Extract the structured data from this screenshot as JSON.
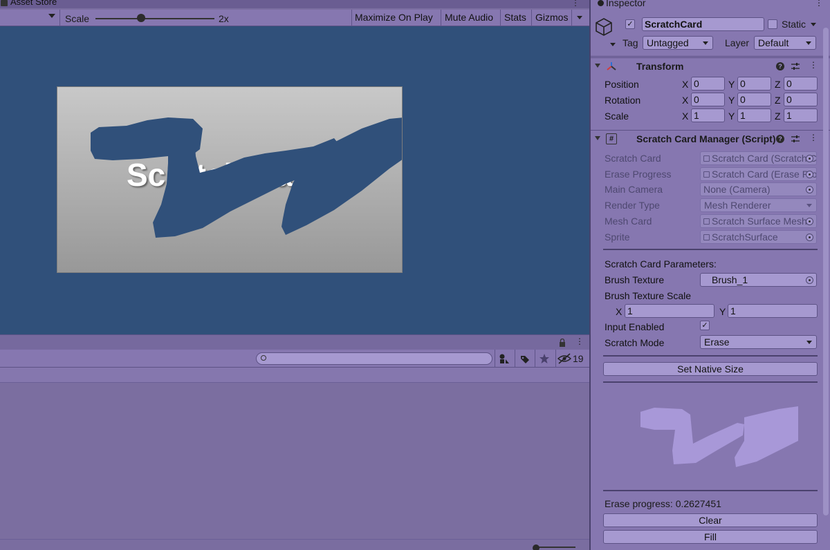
{
  "game_tab": {
    "title": "Asset Store"
  },
  "game_toolbar": {
    "scale_label": "Scale",
    "scale_value": "2x",
    "scale_slider_position": 0.37,
    "buttons": [
      "Maximize On Play",
      "Mute Audio",
      "Stats",
      "Gizmos"
    ]
  },
  "game_view": {
    "background_color": "#30507a",
    "card_text": "Scratch Card"
  },
  "project_panel": {
    "search": {
      "value": "",
      "placeholder": ""
    },
    "hidden_count": "19"
  },
  "inspector": {
    "tab_title": "Inspector",
    "object": {
      "active": true,
      "name": "ScratchCard",
      "static_label": "Static",
      "tag_label": "Tag",
      "tag_value": "Untagged",
      "layer_label": "Layer",
      "layer_value": "Default"
    },
    "transform": {
      "title": "Transform",
      "rows": [
        {
          "label": "Position",
          "x": "0",
          "y": "0",
          "z": "0"
        },
        {
          "label": "Rotation",
          "x": "0",
          "y": "0",
          "z": "0"
        },
        {
          "label": "Scale",
          "x": "1",
          "y": "1",
          "z": "1"
        }
      ],
      "axes": [
        "X",
        "Y",
        "Z"
      ]
    },
    "manager": {
      "title": "Scratch Card Manager (Script)",
      "fields": [
        {
          "label": "Scratch Card",
          "value": "Scratch Card (Scratch Card)"
        },
        {
          "label": "Erase Progress",
          "value": "Scratch Card (Erase Progress)"
        },
        {
          "label": "Main Camera",
          "value": "None (Camera)"
        },
        {
          "label": "Render Type",
          "value": "Mesh Renderer"
        },
        {
          "label": "Mesh Card",
          "value": "Scratch Surface Mesh"
        },
        {
          "label": "Sprite",
          "value": "ScratchSurface"
        }
      ],
      "params_heading": "Scratch Card Parameters:",
      "brush_texture_label": "Brush Texture",
      "brush_texture_value": "Brush_1",
      "brush_scale_label": "Brush Texture Scale",
      "brush_scale_x": "1",
      "brush_scale_y": "1",
      "input_enabled_label": "Input Enabled",
      "input_enabled": true,
      "scratch_mode_label": "Scratch Mode",
      "scratch_mode_value": "Erase",
      "set_native_size_label": "Set Native Size",
      "erase_progress_text": "Erase progress: 0.2627451",
      "clear_label": "Clear",
      "fill_label": "Fill"
    }
  }
}
